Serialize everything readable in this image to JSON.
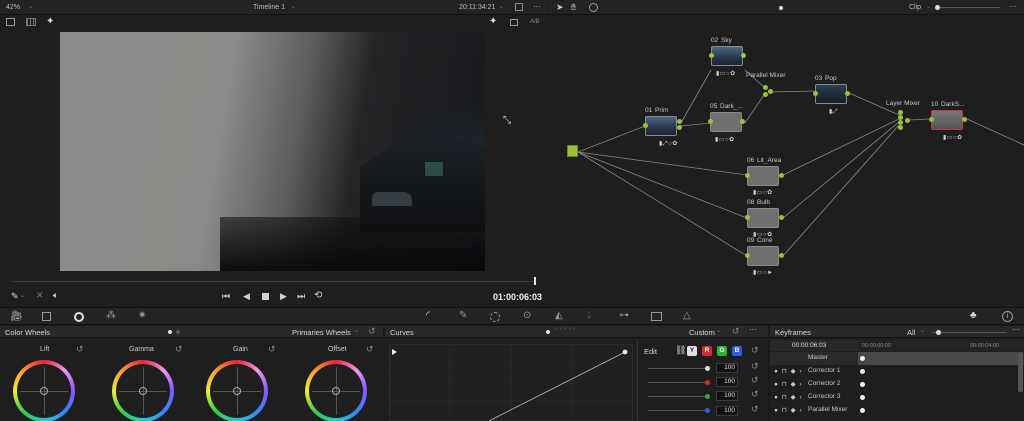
{
  "viewer": {
    "zoom": "42%",
    "timeline": "Timeline 1",
    "timecode_top": "20:11:34:21",
    "ab_label": "A/B",
    "timecode": "01:00:06:03"
  },
  "node_editor": {
    "clip_label": "Clip",
    "nodes": [
      {
        "num": "02",
        "label": "Sky"
      },
      {
        "num": "01",
        "label": "Prim"
      },
      {
        "num": "05",
        "label": "Dark_..."
      },
      {
        "num": "03",
        "label": "Pop"
      },
      {
        "num": "10",
        "label": "DarkS..."
      },
      {
        "num": "06",
        "label": "Lit_Area"
      },
      {
        "num": "08",
        "label": "Bulb"
      },
      {
        "num": "09",
        "label": "Cone"
      }
    ],
    "parallel_mixer": "Parallel Mixer",
    "layer_mixer": "Layer Mixer",
    "link_color": "#9ac23c"
  },
  "color_wheels": {
    "title": "Color Wheels",
    "mode": "Primaries Wheels",
    "wheels": [
      "Lift",
      "Gamma",
      "Gain",
      "Offset"
    ]
  },
  "curves": {
    "title": "Curves",
    "mode": "Custom",
    "edit_label": "Edit",
    "channels": [
      {
        "key": "Y",
        "color": "#e0e0e0"
      },
      {
        "key": "R",
        "color": "#d52b2b"
      },
      {
        "key": "G",
        "color": "#2fae3a"
      },
      {
        "key": "B",
        "color": "#2d5fe0"
      }
    ],
    "values": [
      "100",
      "100",
      "100",
      "100"
    ]
  },
  "keyframes": {
    "title": "Keyframes",
    "filter": "All",
    "timecode": "00:00:06:03",
    "ruler_start": "00:00:00:00",
    "ruler_end": "00:00:04:00",
    "rows": [
      "Master",
      "Corrector 1",
      "Corrector 2",
      "Corrector 3",
      "Parallel Mixer"
    ]
  }
}
